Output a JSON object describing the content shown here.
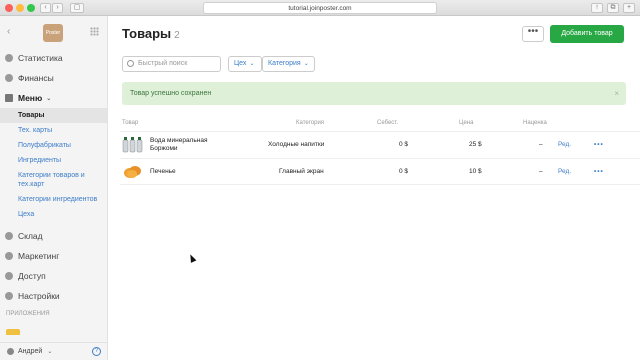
{
  "browser": {
    "url": "tutorial.joinposter.com"
  },
  "sidebar": {
    "logo_text": "Poster",
    "items": [
      {
        "label": "Статистика"
      },
      {
        "label": "Финансы"
      },
      {
        "label": "Меню"
      }
    ],
    "menu_sub": [
      {
        "label": "Товары"
      },
      {
        "label": "Тех. карты"
      },
      {
        "label": "Полуфабрикаты"
      },
      {
        "label": "Ингредиенты"
      },
      {
        "label": "Категории товаров и тех.карт"
      },
      {
        "label": "Категории ингредиентов"
      },
      {
        "label": "Цеха"
      }
    ],
    "items2": [
      {
        "label": "Склад"
      },
      {
        "label": "Маркетинг"
      },
      {
        "label": "Доступ"
      },
      {
        "label": "Настройки"
      }
    ],
    "apps_label": "ПРИЛОЖЕНИЯ",
    "user": "Андрей",
    "help": "?"
  },
  "header": {
    "title": "Товары",
    "count": "2",
    "more_label": "•••",
    "add_label": "Добавить товар"
  },
  "filters": {
    "search_placeholder": "Быстрый поиск",
    "workshop": "Цех",
    "category": "Категория"
  },
  "alert": {
    "text": "Товар успешно сохранен",
    "close": "×"
  },
  "table": {
    "headers": {
      "product": "Товар",
      "category": "Категория",
      "cost": "Себест.",
      "price": "Цена",
      "markup": "Наценка"
    },
    "rows": [
      {
        "name": "Вода минеральная Боржоми",
        "category": "Холодные напитки",
        "cost": "0 $",
        "price": "25 $",
        "markup": "–",
        "edit": "Ред.",
        "more": "•••"
      },
      {
        "name": "Печенье",
        "category": "Главный экран",
        "cost": "0 $",
        "price": "10 $",
        "markup": "–",
        "edit": "Ред.",
        "more": "•••"
      }
    ]
  },
  "colors": {
    "accent": "#28a745",
    "link": "#3d7ec9",
    "alert_bg": "#dff0d8"
  }
}
